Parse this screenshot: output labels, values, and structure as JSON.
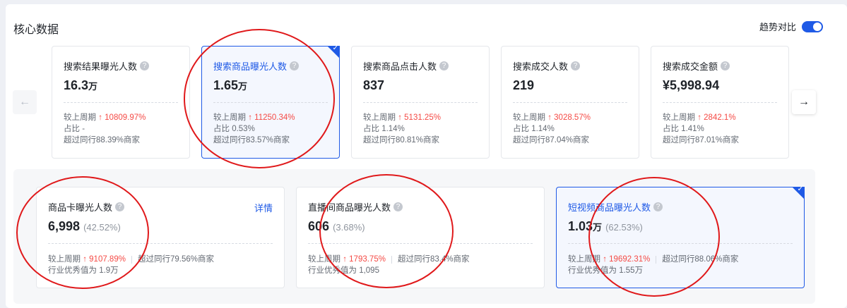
{
  "header": {
    "title": "核心数据",
    "trend_label": "趋势对比"
  },
  "nav": {
    "prev_icon": "←",
    "next_icon": "→"
  },
  "help_icon": "?",
  "check_icon": "✓",
  "metrics": [
    {
      "label": "搜索结果曝光人数",
      "value": "16.3",
      "unit": "万",
      "cmp_label": "较上周期",
      "change": "10809.97%",
      "share": "占比 -",
      "peer": "超过同行88.39%商家"
    },
    {
      "label": "搜索商品曝光人数",
      "value": "1.65",
      "unit": "万",
      "cmp_label": "较上周期",
      "change": "11250.34%",
      "share": "占比 0.53%",
      "peer": "超过同行83.57%商家"
    },
    {
      "label": "搜索商品点击人数",
      "value": "837",
      "unit": "",
      "cmp_label": "较上周期",
      "change": "5131.25%",
      "share": "占比 1.14%",
      "peer": "超过同行80.81%商家"
    },
    {
      "label": "搜索成交人数",
      "value": "219",
      "unit": "",
      "cmp_label": "较上周期",
      "change": "3028.57%",
      "share": "占比 1.14%",
      "peer": "超过同行87.04%商家"
    },
    {
      "label": "搜索成交金额",
      "value": "¥5,998.94",
      "unit": "",
      "cmp_label": "较上周期",
      "change": "2842.1%",
      "share": "占比 1.41%",
      "peer": "超过同行87.01%商家"
    }
  ],
  "sub_metrics": [
    {
      "label": "商品卡曝光人数",
      "value": "6,998",
      "unit": "",
      "pct": "(42.52%)",
      "cmp_label": "较上周期",
      "change": "9107.89%",
      "peer": "超过同行79.56%商家",
      "excellent": "行业优秀值为 1.9万",
      "detail": "详情"
    },
    {
      "label": "直播间商品曝光人数",
      "value": "606",
      "unit": "",
      "pct": "(3.68%)",
      "cmp_label": "较上周期",
      "change": "1793.75%",
      "peer": "超过同行83.4%商家",
      "excellent": "行业优秀值为 1,095"
    },
    {
      "label": "短视频商品曝光人数",
      "value": "1.03",
      "unit": "万",
      "pct": "(62.53%)",
      "cmp_label": "较上周期",
      "change": "19692.31%",
      "peer": "超过同行88.06%商家",
      "excellent": "行业优秀值为 1.55万"
    }
  ],
  "colors": {
    "accent": "#1f5ae6",
    "up": "#f54a45",
    "annotation": "#e0191b"
  }
}
